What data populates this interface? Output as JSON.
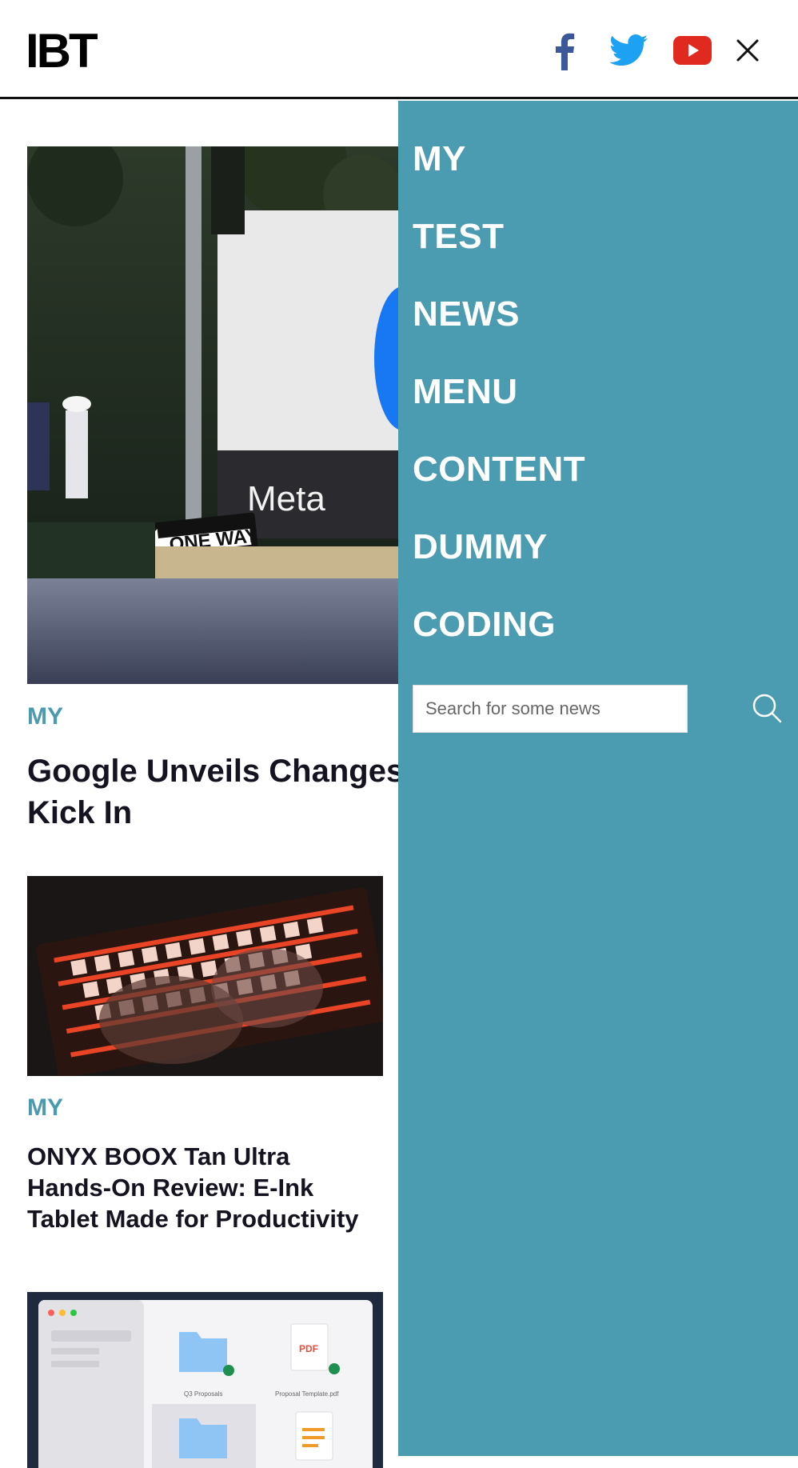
{
  "header": {
    "logo": "IBT",
    "icons": {
      "facebook": "facebook-icon",
      "twitter": "twitter-icon",
      "youtube": "youtube-icon",
      "close": "close-icon"
    }
  },
  "colors": {
    "accent": "#4a9ab0",
    "menu_bg": "#4b9bb1",
    "facebook": "#3b5998",
    "twitter": "#1da1f2",
    "youtube": "#e02a20"
  },
  "articles": [
    {
      "category": "MY",
      "title": "Google Unveils Changes Kick In",
      "image_text": "Meta",
      "sign_text": "ONE WAY"
    },
    {
      "category": "MY",
      "title": "ONYX BOOX Tan Ultra Hands-On Review: E-Ink Tablet Made for Productivity"
    },
    {
      "image_labels": [
        "Q3 Proposals",
        "Proposal Template.pdf"
      ],
      "pdf_badge": "PDF"
    }
  ],
  "menu": {
    "items": [
      "MY",
      "TEST",
      "NEWS",
      "MENU",
      "CONTENT",
      "DUMMY",
      "CODING"
    ],
    "search": {
      "placeholder": "Search for some news",
      "value": ""
    }
  }
}
